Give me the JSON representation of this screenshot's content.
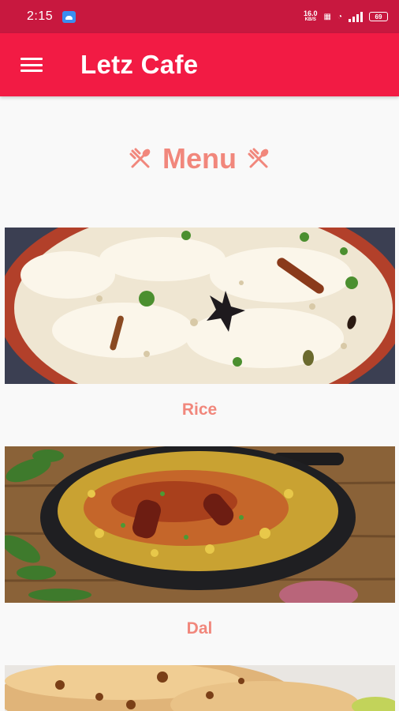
{
  "status_bar": {
    "time": "2:15",
    "net_speed_value": "16.0",
    "net_speed_unit": "KB/S",
    "battery": "69"
  },
  "app_bar": {
    "title": "Letz Cafe",
    "menu_icon": "hamburger-menu-icon"
  },
  "section": {
    "title": "Menu",
    "left_icon": "fork-spoon-icon",
    "right_icon": "fork-spoon-icon"
  },
  "menu_items": [
    {
      "label": "Rice",
      "image": "rice-dish"
    },
    {
      "label": "Dal",
      "image": "dal-dish"
    },
    {
      "label": "",
      "image": "roti-dish"
    }
  ],
  "colors": {
    "status_bar": "#c8183f",
    "app_bar": "#f21b44",
    "accent_text": "#f1877c",
    "background": "#f9f9f9"
  }
}
